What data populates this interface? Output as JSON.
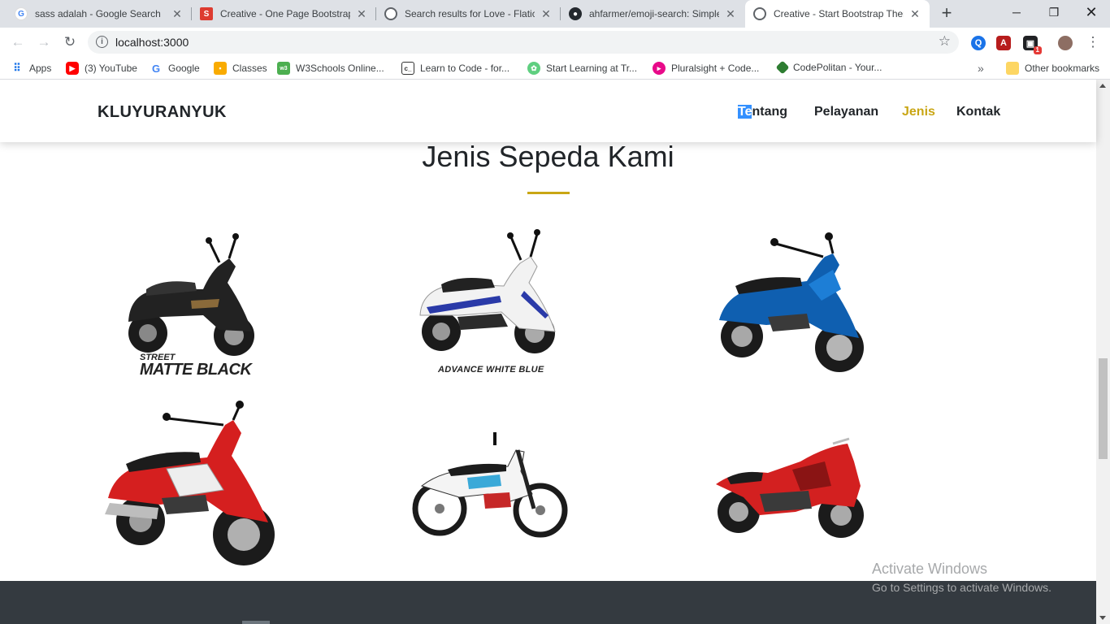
{
  "tabs": [
    {
      "title": "sass adalah - Google Search",
      "icon": "google-icon"
    },
    {
      "title": "Creative - One Page Bootstrap",
      "icon": "startbootstrap-icon"
    },
    {
      "title": "Search results for Love - Flatico",
      "icon": "globe-icon"
    },
    {
      "title": "ahfarmer/emoji-search: Simple",
      "icon": "github-icon"
    },
    {
      "title": "Creative - Start Bootstrap Then",
      "icon": "globe-icon"
    }
  ],
  "toolbar": {
    "url": "localhost:3000"
  },
  "bookmarks": [
    {
      "label": "Apps",
      "icon": "apps-grid-icon"
    },
    {
      "label": "(3) YouTube",
      "icon": "youtube-icon"
    },
    {
      "label": "Google",
      "icon": "google-icon"
    },
    {
      "label": "Classes",
      "icon": "classroom-icon"
    },
    {
      "label": "W3Schools Online...",
      "icon": "w3schools-icon"
    },
    {
      "label": "Learn to Code - for...",
      "icon": "freecodecamp-icon"
    },
    {
      "label": "Start Learning at Tr...",
      "icon": "treehouse-icon"
    },
    {
      "label": "Pluralsight + Code...",
      "icon": "pluralsight-icon"
    },
    {
      "label": "CodePolitan - Your...",
      "icon": "codepolitan-icon"
    }
  ],
  "other_bookmarks": "Other bookmarks",
  "site": {
    "brand": "KLUYURANYUK",
    "nav": {
      "tentang_selected": "Te",
      "tentang_rest": "ntang",
      "pelayanan": "Pelayanan",
      "jenis": "Jenis",
      "kontak": "Kontak"
    },
    "section_title": "Jenis Sepeda Kami",
    "captions": {
      "street": "STREET",
      "matte_black": "MATTE BLACK",
      "advance": "ADVANCE WHITE BLUE"
    }
  },
  "watermark": {
    "line1": "Activate Windows",
    "line2": "Go to Settings to activate Windows."
  },
  "colors": {
    "accent": "#c9a614",
    "footer": "#343a40"
  }
}
